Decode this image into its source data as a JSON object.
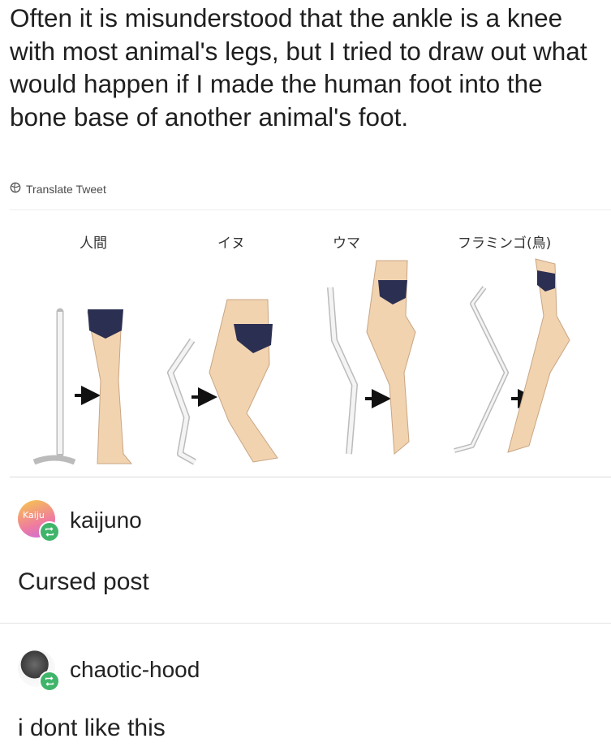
{
  "tweet": {
    "text": "Often it is misunderstood that the ankle is a knee with most animal's legs, but I tried to draw out what would happen if I made the human foot into the bone base of another animal's foot.",
    "translate_label": "Translate Tweet"
  },
  "figure": {
    "panels": [
      {
        "label": "人間"
      },
      {
        "label": "イヌ"
      },
      {
        "label": "ウマ"
      },
      {
        "label": "フラミンゴ(鳥)"
      }
    ],
    "colors": {
      "skin": "#f1d3b0",
      "bone": "#f4f4f4",
      "briefs": "#2b2f52"
    }
  },
  "posts": [
    {
      "username": "kaijuno",
      "avatar_text": "Kaiju",
      "comment": "Cursed post"
    },
    {
      "username": "chaotic-hood",
      "comment": "i dont like this"
    }
  ],
  "colors": {
    "reblog_badge": "#3fb46a"
  }
}
